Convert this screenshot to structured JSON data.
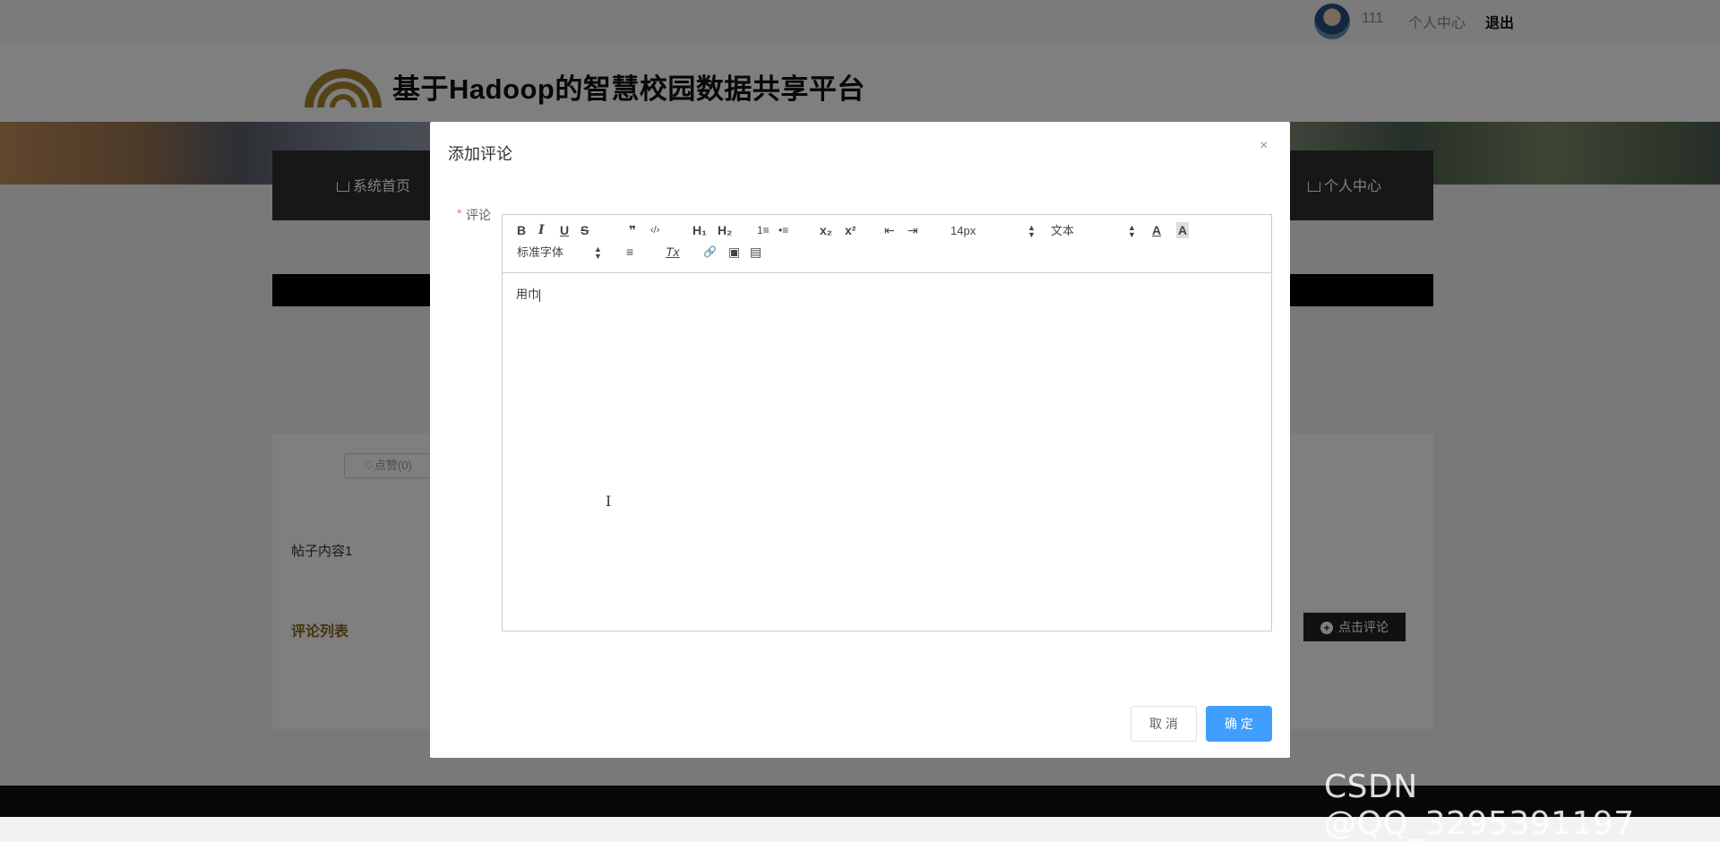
{
  "topbar": {
    "username": "111",
    "personal_center": "个人中心",
    "logout": "退出"
  },
  "site": {
    "title": "基于Hadoop的智慧校园数据共享平台"
  },
  "nav": {
    "home": "系统首页",
    "personal_center": "个人中心"
  },
  "post": {
    "like_label": "♡点赞(0)",
    "content": "帖子内容1",
    "comment_list_title": "评论列表",
    "comment_button": "点击评论"
  },
  "dialog": {
    "title": "添加评论",
    "close": "×",
    "required_mark": "*",
    "field_label": "评论",
    "editor": {
      "toolbar": {
        "bold": "B",
        "italic": "I",
        "underline": "U",
        "strike": "S",
        "blockquote": "❞",
        "code": "‹/›",
        "h1": "H₁",
        "h2": "H₂",
        "ordered_list": "1≡",
        "bullet_list": "•≡",
        "subscript": "x₂",
        "superscript": "x²",
        "outdent": "⇤",
        "indent": "⇥",
        "size": "14px",
        "header": "文本",
        "font": "标准字体",
        "color": "A",
        "background": "A",
        "align": "≡",
        "clean": "Tx",
        "link": "🔗",
        "image": "▣",
        "video": "▤"
      },
      "content": "用巾"
    },
    "cancel": "取 消",
    "confirm": "确 定"
  },
  "watermark": "CSDN @QQ_3295391197"
}
